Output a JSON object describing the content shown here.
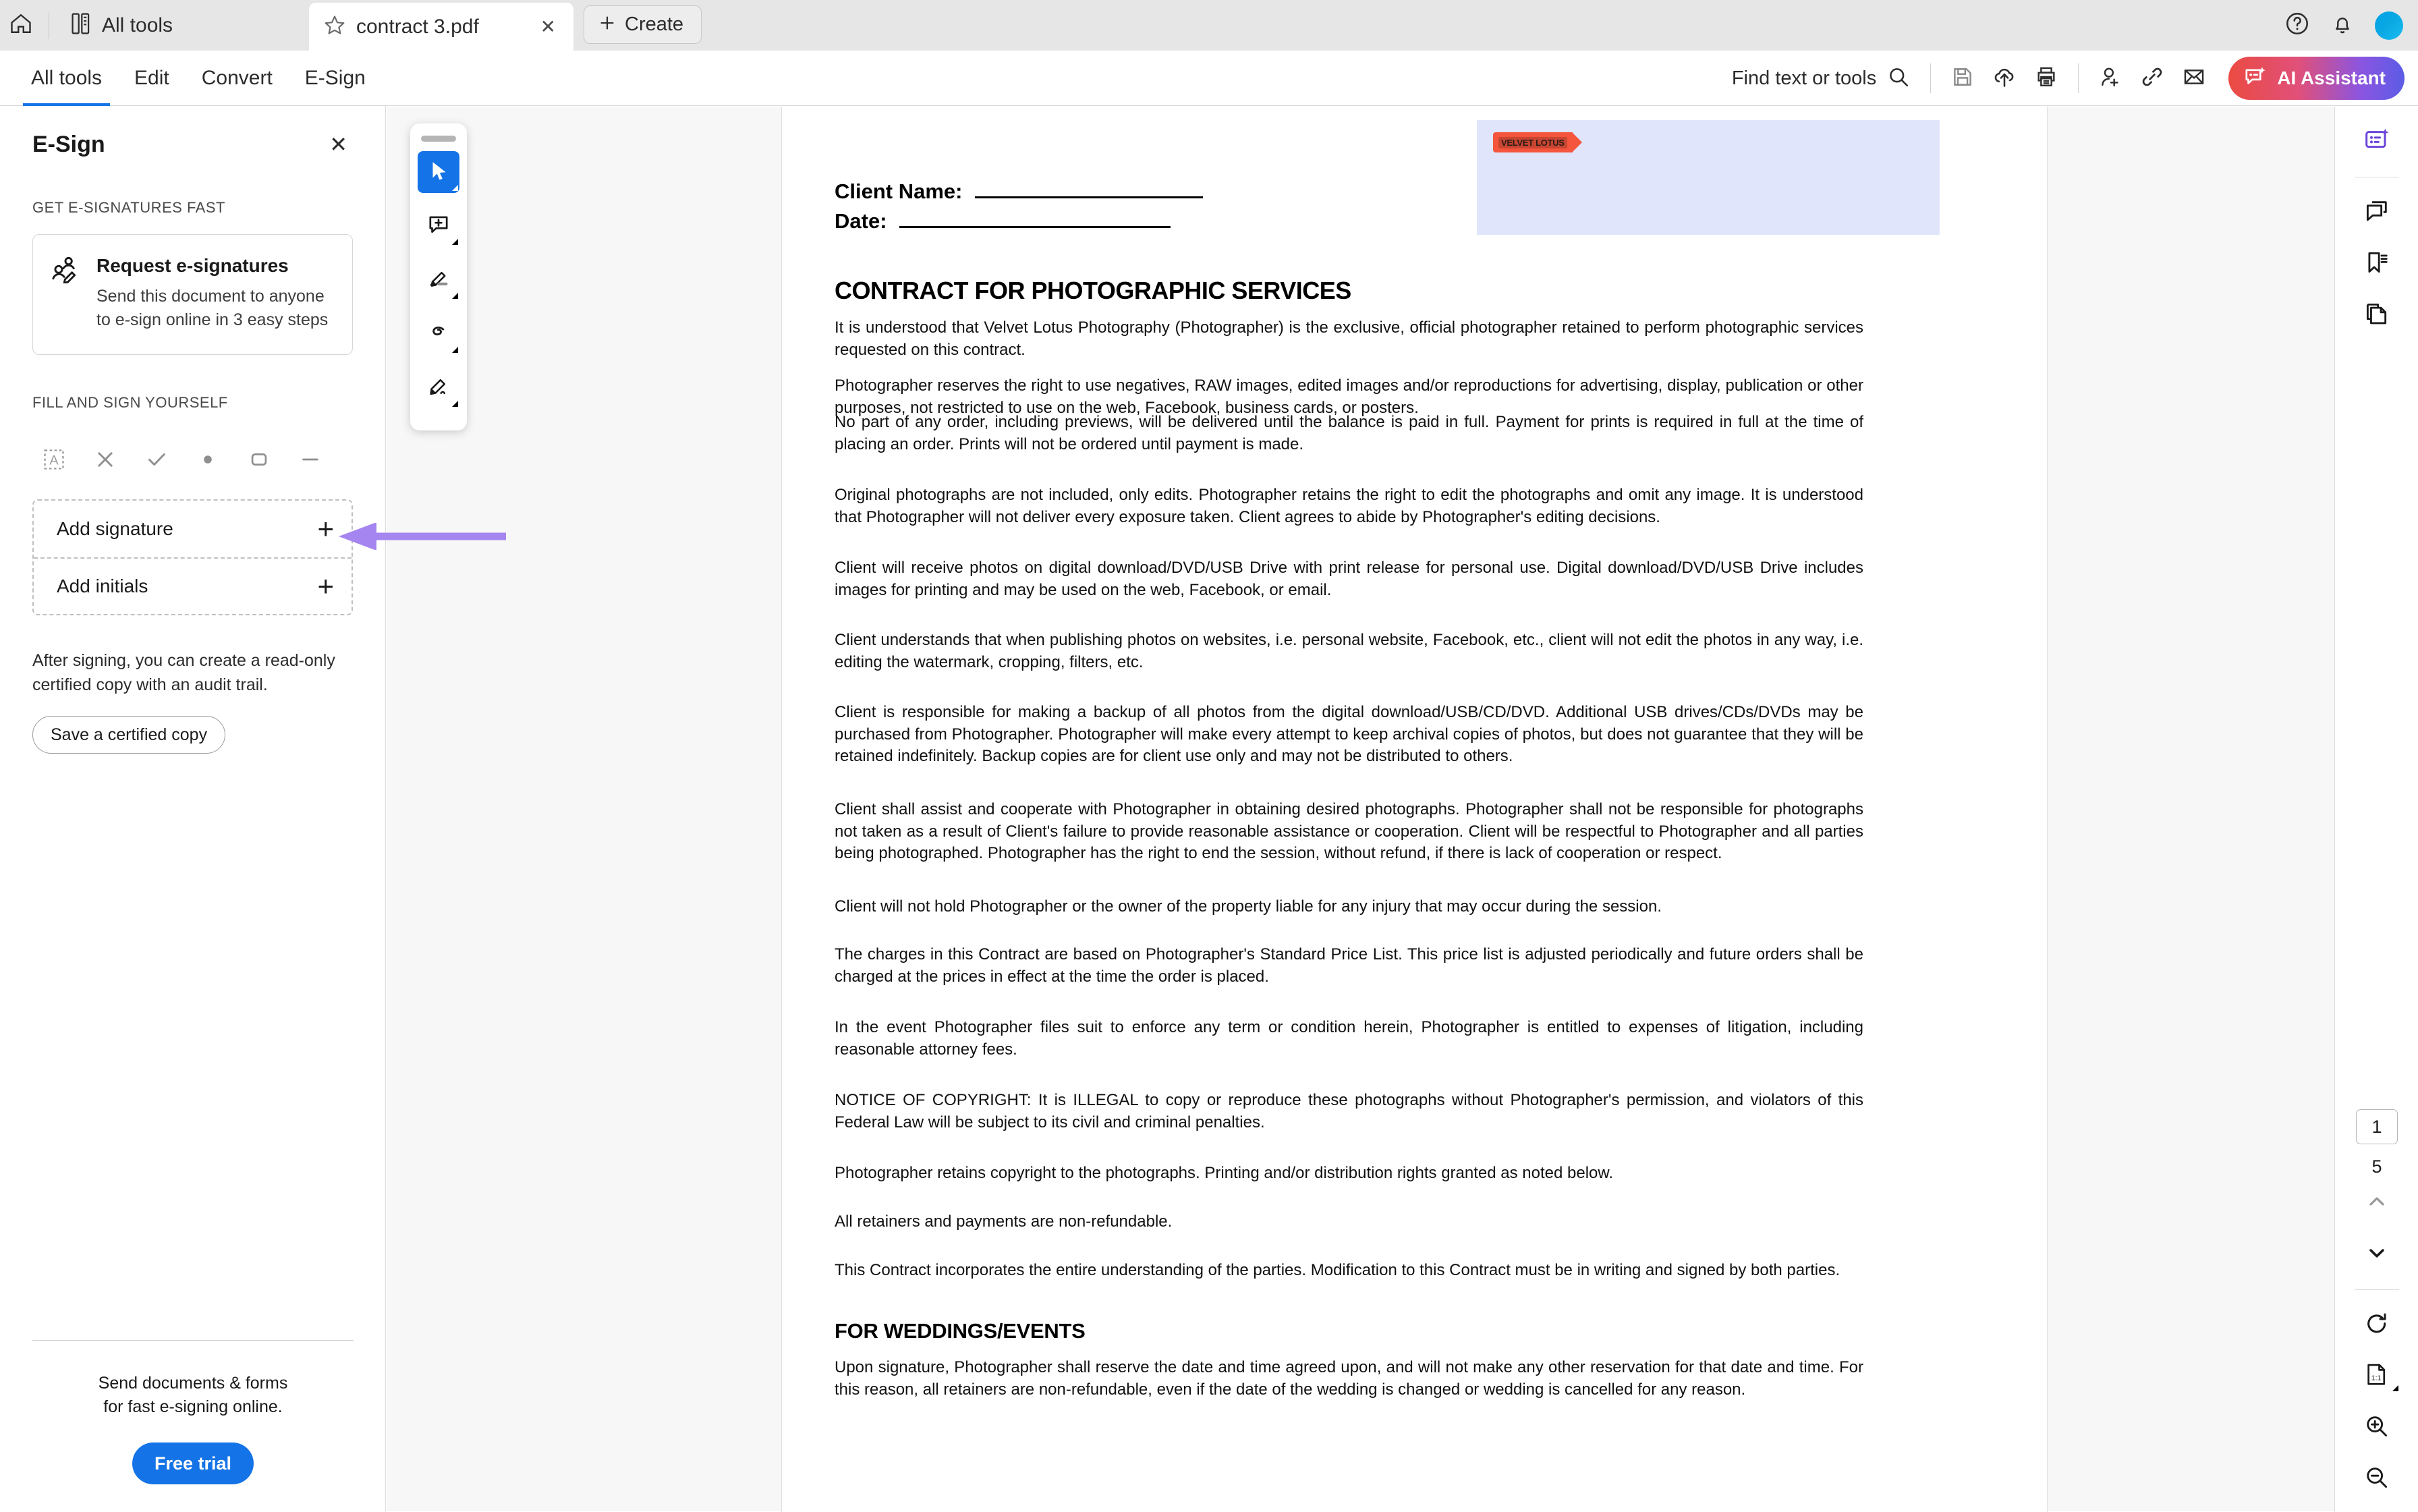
{
  "tabbar": {
    "home_label": "Home",
    "all_tools_label": "All tools",
    "doc_tab_title": "contract 3.pdf",
    "doc_tab_close": "✕",
    "create_label": "Create"
  },
  "toolbar": {
    "menu_tabs": [
      {
        "label": "All tools",
        "active": true
      },
      {
        "label": "Edit",
        "active": false
      },
      {
        "label": "Convert",
        "active": false
      },
      {
        "label": "E-Sign",
        "active": false
      }
    ],
    "find_label": "Find text or tools",
    "ai_label": "AI Assistant",
    "icons": [
      "save-icon",
      "upload-cloud-icon",
      "print-icon",
      "add-person-icon",
      "link-icon",
      "email-icon"
    ]
  },
  "esign_panel": {
    "title": "E-Sign",
    "close_label": "✕",
    "section_get": "GET E-SIGNATURES FAST",
    "request_card": {
      "title": "Request e-signatures",
      "desc": "Send this document to anyone to e-sign online in 3 easy steps"
    },
    "section_fill": "FILL AND SIGN YOURSELF",
    "fill_icons": [
      "add-text-icon",
      "cross-mark-icon",
      "check-mark-icon",
      "dot-icon",
      "rounded-rect-icon",
      "line-icon"
    ],
    "add_signature_label": "Add signature",
    "add_initials_label": "Add initials",
    "plus_glyph": "+",
    "note": "After signing, you can create a read-only certified copy with an audit trail.",
    "certified_copy_label": "Save a certified copy",
    "footer_line1": "Send documents & forms",
    "footer_line2": "for fast e-signing online.",
    "trial_label": "Free trial"
  },
  "annotation": {
    "arrow_color": "#a585f0",
    "target": "add-signature-plus"
  },
  "palette": {
    "items": [
      {
        "name": "select-cursor-icon",
        "selected": true
      },
      {
        "name": "add-comment-icon",
        "selected": false
      },
      {
        "name": "highlight-pen-icon",
        "selected": false
      },
      {
        "name": "draw-lasso-icon",
        "selected": false
      },
      {
        "name": "signature-pen-icon",
        "selected": false
      }
    ]
  },
  "document": {
    "client_name_label": "Client Name:",
    "client_name_value": "",
    "date_label": "Date:",
    "date_value": "",
    "signature_field_tag": "VELVET LOTUS",
    "signature_field_color": "#e0e5fb",
    "signature_tag_color": "#f4553c",
    "heading": "CONTRACT FOR PHOTOGRAPHIC SERVICES",
    "paragraphs": [
      "It is understood that Velvet Lotus Photography (Photographer) is the exclusive, official photographer retained to perform photographic services requested on this contract.",
      "Photographer reserves the right to use negatives, RAW images, edited images and/or reproductions for advertising, display, publication or other purposes, not restricted to use on the web, Facebook, business cards, or posters.",
      "No part of any order, including previews, will be delivered until the balance is paid in full. Payment for prints is required in full at the time of placing an order. Prints will not be ordered until payment is made.",
      "Original photographs are not included, only edits. Photographer retains the right to edit the photographs and omit any image. It is understood that Photographer will not deliver every exposure taken. Client agrees to abide by Photographer's editing decisions.",
      "Client will receive photos on digital download/DVD/USB Drive with print release for personal use. Digital download/DVD/USB Drive includes images for printing and may be used on the web, Facebook, or email.",
      "Client understands that when publishing photos on websites, i.e. personal website, Facebook, etc., client will not edit the photos in any way, i.e. editing the watermark, cropping, filters, etc.",
      "Client is responsible for making a backup of all photos from the digital download/USB/CD/DVD. Additional USB drives/CDs/DVDs may be purchased from Photographer. Photographer will make every attempt to keep archival copies of photos, but does not guarantee that they will be retained indefinitely. Backup copies are for client use only and may not be distributed to others.",
      "Client shall assist and cooperate with Photographer in obtaining desired photographs. Photographer shall not be responsible for photographs not taken as a result of Client's failure to provide reasonable assistance or cooperation. Client will be respectful to Photographer and all parties being photographed. Photographer has the right to end the session, without refund, if there is lack of cooperation or respect.",
      "Client will not hold Photographer or the owner of the property liable for any injury that may occur during the session.",
      "The charges in this Contract are based on Photographer's Standard Price List. This price list is adjusted periodically and future orders shall be charged at the prices in effect at the time the order is placed.",
      "In the event Photographer files suit to enforce any term or condition herein, Photographer is entitled to expenses of litigation, including reasonable attorney fees.",
      "NOTICE OF COPYRIGHT: It is ILLEGAL to copy or reproduce these photographs without Photographer's permission, and violators of this Federal Law will be subject to its civil and criminal penalties.",
      "Photographer retains copyright to the photographs. Printing and/or distribution rights granted as noted below.",
      "All retainers and payments are non-refundable.",
      "This Contract incorporates the entire understanding of the parties. Modification to this Contract must be in writing and signed by both parties."
    ],
    "subheading": "FOR WEDDINGS/EVENTS",
    "subheading_paragraph": "Upon signature, Photographer shall reserve the date and time agreed upon, and will not make any other reservation for that date and time. For this reason, all retainers are non-refundable, even if the date of the wedding is changed or wedding is cancelled for any reason."
  },
  "right_rail": {
    "top_icons": [
      "ai-assistant-icon",
      "comment-icon",
      "bookmark-icon",
      "copy-pages-icon"
    ],
    "current_page": "1",
    "total_pages": "5",
    "bottom_icons": [
      "chevron-up-icon",
      "chevron-down-icon",
      "rotate-icon",
      "fit-1to1-icon",
      "zoom-in-icon",
      "zoom-out-icon"
    ]
  },
  "colors": {
    "accent_blue": "#1473e6",
    "ai_purple": "#5b5ce6",
    "annotation_purple": "#a585f0",
    "topbar_gray": "#e6e6e6",
    "viewer_gray": "#f7f7f7"
  }
}
